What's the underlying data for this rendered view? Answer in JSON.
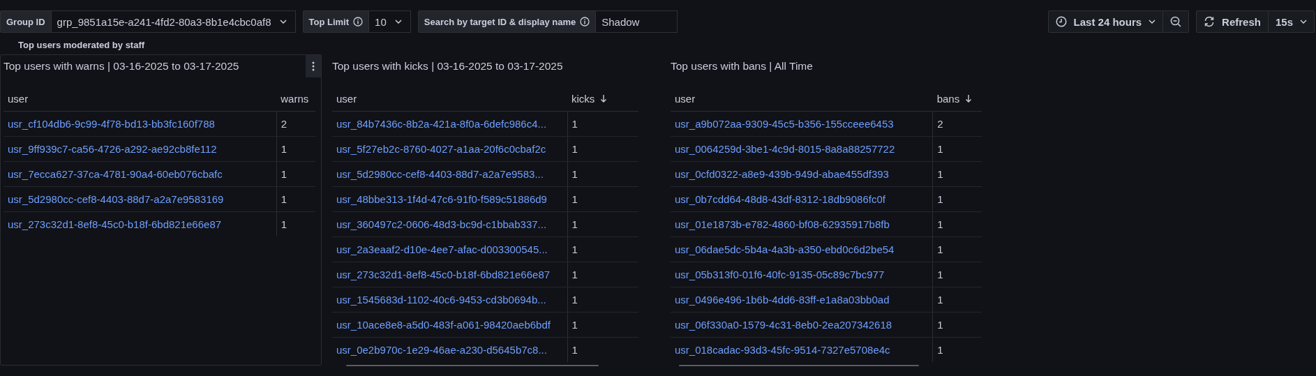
{
  "toolbar": {
    "variables": [
      {
        "label": "Group ID",
        "info": false,
        "kind": "select",
        "value": "grp_9851a15e-a241-4fd2-80a3-8b1e4cbc0af8"
      },
      {
        "label": "Top Limit",
        "info": true,
        "kind": "select",
        "value": "10"
      },
      {
        "label": "Search by target ID & display name",
        "info": true,
        "kind": "text",
        "value": "Shadow"
      }
    ],
    "time_range": {
      "label": "Last 24 hours"
    },
    "refresh": {
      "label": "Refresh",
      "interval": "15s"
    }
  },
  "row_title": "Top users moderated by staff",
  "panels": [
    {
      "title": "Top users with warns | 03-16-2025 to 03-17-2025",
      "menu_visible": true,
      "h_scroll": false,
      "columns": [
        {
          "label": "user",
          "sorted": false
        },
        {
          "label": "warns",
          "sorted": false
        }
      ],
      "rows": [
        [
          "usr_cf104db6-9c99-4f78-bd13-bb3fc160f788",
          "2"
        ],
        [
          "usr_9ff939c7-ca56-4726-a292-ae92cb8fe112",
          "1"
        ],
        [
          "usr_7ecca627-37ca-4781-90a4-60eb076cbafc",
          "1"
        ],
        [
          "usr_5d2980cc-cef8-4403-88d7-a2a7e9583169",
          "1"
        ],
        [
          "usr_273c32d1-8ef8-45c0-b18f-6bd821e66e87",
          "1"
        ]
      ]
    },
    {
      "title": "Top users with kicks | 03-16-2025 to 03-17-2025",
      "menu_visible": false,
      "h_scroll": true,
      "columns": [
        {
          "label": "user",
          "sorted": false
        },
        {
          "label": "kicks",
          "sorted": true
        }
      ],
      "rows": [
        [
          "usr_84b7436c-8b2a-421a-8f0a-6defc986c4...",
          "1"
        ],
        [
          "usr_5f27eb2c-8760-4027-a1aa-20f6c0cbaf2c",
          "1"
        ],
        [
          "usr_5d2980cc-cef8-4403-88d7-a2a7e9583...",
          "1"
        ],
        [
          "usr_48bbe313-1f4d-47c6-91f0-f589c51886d9",
          "1"
        ],
        [
          "usr_360497c2-0606-48d3-bc9d-c1bbab337...",
          "1"
        ],
        [
          "usr_2a3eaaf2-d10e-4ee7-afac-d003300545...",
          "1"
        ],
        [
          "usr_273c32d1-8ef8-45c0-b18f-6bd821e66e87",
          "1"
        ],
        [
          "usr_1545683d-1102-40c6-9453-cd3b0694b...",
          "1"
        ],
        [
          "usr_10ace8e8-a5d0-483f-a061-98420aeb6bdf",
          "1"
        ],
        [
          "usr_0e2b970c-1e29-46ae-a230-d5645b7c8...",
          "1"
        ]
      ]
    },
    {
      "title": "Top users with bans | All Time",
      "menu_visible": false,
      "h_scroll": true,
      "columns": [
        {
          "label": "user",
          "sorted": false
        },
        {
          "label": "bans",
          "sorted": true
        }
      ],
      "rows": [
        [
          "usr_a9b072aa-9309-45c5-b356-155cceee6453",
          "2"
        ],
        [
          "usr_0064259d-3be1-4c9d-8015-8a8a88257722",
          "1"
        ],
        [
          "usr_0cfd0322-a8e9-439b-949d-abae455df393",
          "1"
        ],
        [
          "usr_0b7cdd64-48d8-43df-8312-18db9086fc0f",
          "1"
        ],
        [
          "usr_01e1873b-e782-4860-bf08-62935917b8fb",
          "1"
        ],
        [
          "usr_06dae5dc-5b4a-4a3b-a350-ebd0c6d2be54",
          "1"
        ],
        [
          "usr_05b313f0-01f6-40fc-9135-05c89c7bc977",
          "1"
        ],
        [
          "usr_0496e496-1b6b-4dd6-83ff-e1a8a03bb0ad",
          "1"
        ],
        [
          "usr_06f330a0-1579-4c31-8eb0-2ea207342618",
          "1"
        ],
        [
          "usr_018cadac-93d3-45fc-9514-7327e5708e4c",
          "1"
        ]
      ]
    }
  ]
}
